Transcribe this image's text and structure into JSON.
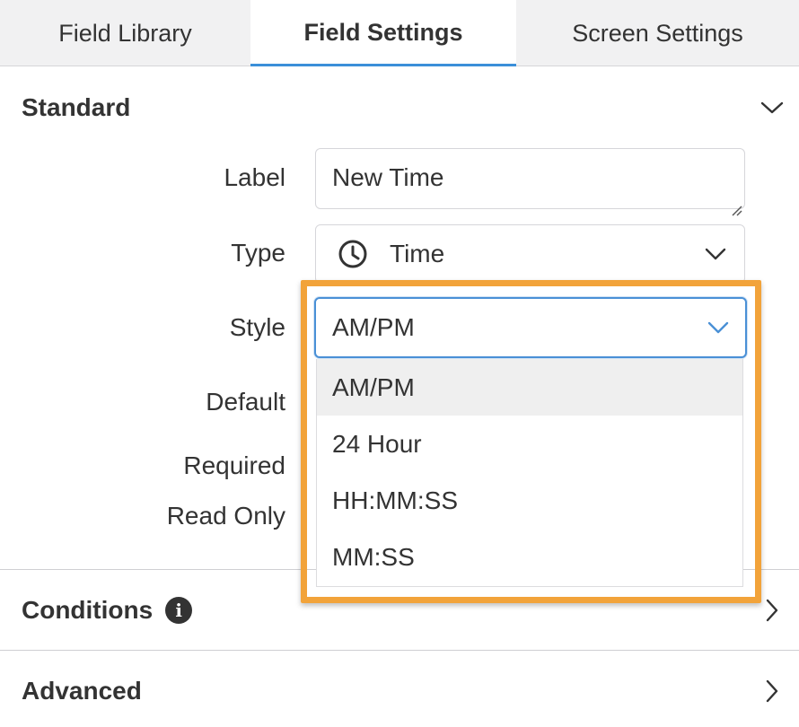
{
  "tabs": [
    {
      "label": "Field Library"
    },
    {
      "label": "Field Settings"
    },
    {
      "label": "Screen Settings"
    }
  ],
  "standard": {
    "title": "Standard",
    "icon": "chevron-down-icon",
    "fields": {
      "label": {
        "label": "Label",
        "value": "New Time"
      },
      "type": {
        "label": "Type",
        "value": "Time",
        "icon": "clock-icon"
      },
      "style": {
        "label": "Style",
        "value": "AM/PM"
      },
      "default": {
        "label": "Default"
      },
      "required": {
        "label": "Required"
      },
      "read_only": {
        "label": "Read Only"
      }
    }
  },
  "style_options": [
    "AM/PM",
    "24 Hour",
    "HH:MM:SS",
    "MM:SS"
  ],
  "selected_option": "AM/PM",
  "conditions": {
    "title": "Conditions",
    "info_glyph": "i",
    "icon": "chevron-right-icon"
  },
  "advanced": {
    "title": "Advanced",
    "icon": "chevron-right-icon"
  },
  "colors": {
    "accent": "#3b8fd9",
    "highlight": "#f2a33a",
    "text": "#333333",
    "tab_bg": "#f1f1f2"
  }
}
